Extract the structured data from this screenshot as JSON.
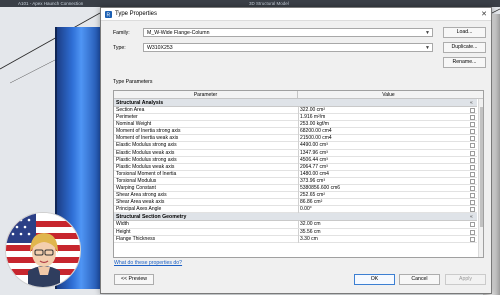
{
  "background": {
    "tabs": [
      "A101 - Apex Haunch Connection",
      "3D Structural Model"
    ]
  },
  "dialog": {
    "title": "Type Properties",
    "family_label": "Family:",
    "family_value": "M_W-Wide Flange-Column",
    "type_label": "Type:",
    "type_value": "W310X253",
    "load_button": "Load...",
    "duplicate_button": "Duplicate...",
    "rename_button": "Rename...",
    "type_parameters_label": "Type Parameters",
    "columns": {
      "parameter": "Parameter",
      "value": "Value"
    },
    "groups": [
      {
        "name": "Structural Analysis",
        "rows": [
          {
            "param": "Section Area",
            "value": "322.00 cm²"
          },
          {
            "param": "Perimeter",
            "value": "1.916 m²/m"
          },
          {
            "param": "Nominal Weight",
            "value": "253.00 kgf/m"
          },
          {
            "param": "Moment of Inertia strong axis",
            "value": "68200.00 cm4"
          },
          {
            "param": "Moment of Inertia weak axis",
            "value": "21500.00 cm4"
          },
          {
            "param": "Elastic Modulus strong axis",
            "value": "4490.00 cm³"
          },
          {
            "param": "Elastic Modulus weak axis",
            "value": "1347.96 cm³"
          },
          {
            "param": "Plastic Modulus strong axis",
            "value": "4506.44 cm³"
          },
          {
            "param": "Plastic Modulus weak axis",
            "value": "2064.77 cm³"
          },
          {
            "param": "Torsional Moment of Inertia",
            "value": "1480.00 cm4"
          },
          {
            "param": "Torsional Modulus",
            "value": "373.96 cm³"
          },
          {
            "param": "Warping Constant",
            "value": "5380856.600 cm6"
          },
          {
            "param": "Shear Area strong axis",
            "value": "252.65 cm²"
          },
          {
            "param": "Shear Area weak axis",
            "value": "86.86 cm²"
          },
          {
            "param": "Principal Axes Angle",
            "value": "0.00°"
          }
        ]
      },
      {
        "name": "Structural Section Geometry",
        "rows": [
          {
            "param": "Width",
            "value": "32.00 cm"
          },
          {
            "param": "Height",
            "value": "35.56 cm"
          },
          {
            "param": "Flange Thickness",
            "value": "3.30 cm"
          }
        ]
      }
    ],
    "help_link": "What do these properties do?",
    "preview_button": "<< Preview",
    "ok_button": "OK",
    "cancel_button": "Cancel",
    "apply_button": "Apply"
  },
  "colors": {
    "accent": "#3c7fd2",
    "link": "#1a5fc4",
    "column_blue": "#2f6fd6"
  }
}
